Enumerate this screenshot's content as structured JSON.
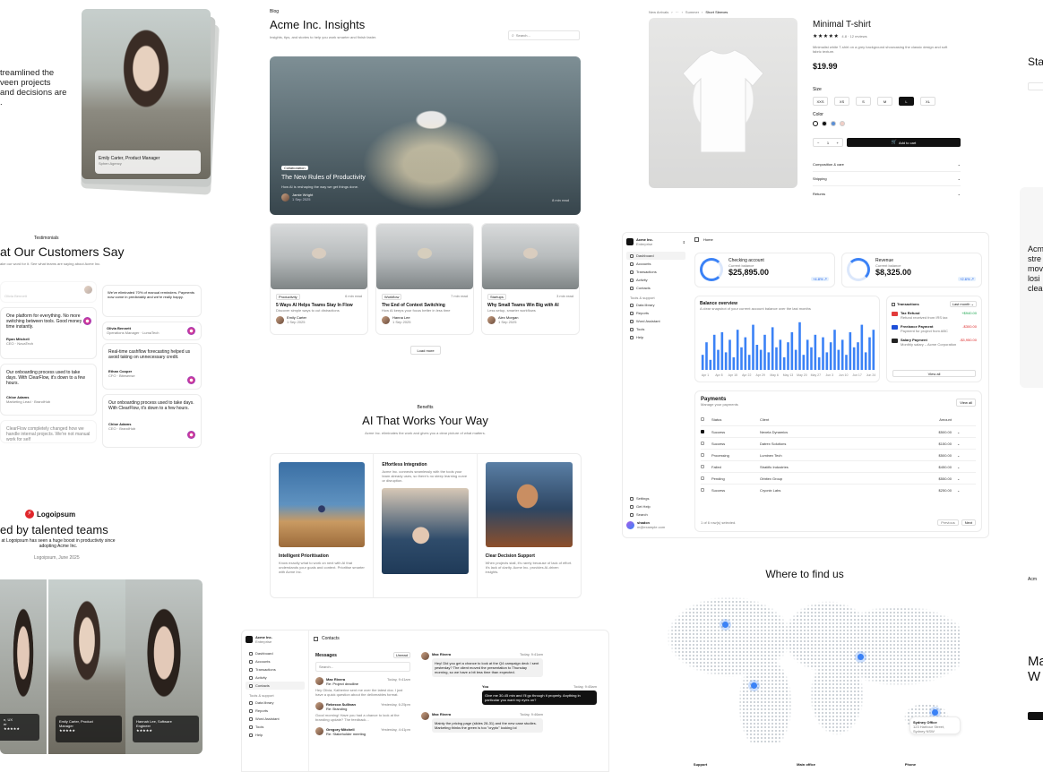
{
  "hero_left": {
    "text_lines": [
      "treamlined the",
      "veen projects",
      "and decisions are",
      "."
    ],
    "person_card": {
      "name": "Emily Carter, Product Manager",
      "company": "Sphen Agency"
    }
  },
  "testimonials": {
    "eyebrow": "Testimonials",
    "title": "at Our Customers Say",
    "subtitle": "ake our word for it. See what teams are saying about Acme Inc.",
    "items": [
      {
        "quote": "One platform for everything. No more switching between tools. Good money and time instantly.",
        "name": "Ryan Mitchell",
        "role": "CEO · NovaTech"
      },
      {
        "quote": "Our onboarding process used to take days. With ClearFlow, it's down to a few hours.",
        "name": "Chloe Adams",
        "role": "Marketing Lead · BrandHub"
      },
      {
        "quote": "ClearFlow completely changed how we handle internal projects. We're not manual work for self",
        "name": "",
        "role": ""
      },
      {
        "quote": "We've eliminated 70% of manual reminders. Payments now come in predictably and we're really happy.",
        "name": "Olivia Bennett",
        "role": "Operations Manager · LumaTech"
      },
      {
        "quote": "Real-time cashflow forecasting helped us avoid taking on unnecessary credit.",
        "name": "Ethan Cooper",
        "role": "CFO · Bitesense"
      },
      {
        "quote": "Our onboarding process used to take days. With ClearFlow, it's down to a few hours.",
        "name": "Chloe Adams",
        "role": "CEO · BrandHub"
      }
    ]
  },
  "logo_section": {
    "logo_text": "Logoipsum",
    "title": "ed by talented teams",
    "quote": "at Logoipsum has seen a huge boost in productivity since adopting Acme Inc.",
    "attribution": "Logoipsum, June 2025",
    "people": [
      {
        "name": "n, UX",
        "role": "er"
      },
      {
        "name": "Emily Carter, Product",
        "role": "Manager"
      },
      {
        "name": "Hannah Lee, Software",
        "role": "Engineer"
      }
    ],
    "stars": "★★★★★"
  },
  "blog": {
    "eyebrow": "Blog",
    "title": "Acme Inc. Insights",
    "subtitle": "Insights, tips, and stories to help you work smarter and finish faster.",
    "search_placeholder": "Search...",
    "featured": {
      "tag": "Collaboration",
      "title": "The New Rules of Productivity",
      "desc": "How AI is reshaping the way we get things done.",
      "author": "Jamie Wright",
      "date": "1 Sep 2025",
      "read": "8 min read"
    },
    "posts": [
      {
        "tag": "Productivity",
        "read": "6 min read",
        "title": "5 Ways AI Helps Teams Stay In Flow",
        "desc": "Discover simple ways to cut distractions",
        "author": "Emily Carter",
        "date": "1 Sep 2025"
      },
      {
        "tag": "Workflow",
        "read": "7 min read",
        "title": "The End of Context Switching",
        "desc": "How AI keeps your focus better in less time",
        "author": "Hanna Lee",
        "date": "1 Sep 2025"
      },
      {
        "tag": "Startups",
        "read": "3 min read",
        "title": "Why Small Teams Win Big with AI",
        "desc": "Less setup, smarter workflows",
        "author": "Alex Morgan",
        "date": "1 Sep 2025"
      }
    ],
    "load_more": "Load more"
  },
  "benefits": {
    "eyebrow": "Benefits",
    "title": "AI That Works Your Way",
    "subtitle": "Acme Inc. eliminates the work and gives you a clear picture of what matters.",
    "items": [
      {
        "title": "Intelligent Prioritisation",
        "desc": "Know exactly what to work on next with AI that understands your goals and context. Prioritise smarter with Acme Inc."
      },
      {
        "title": "Effortless Integration",
        "desc": "Acme Inc. connects seamlessly with the tools your team already uses, so there's no steep learning curve or disruption."
      },
      {
        "title": "Clear Decision Support",
        "desc": "When projects stall, it's rarely because of lack of effort. It's lack of clarity. Acme Inc. provides AI-driven insights."
      }
    ]
  },
  "product": {
    "breadcrumb": [
      "New Arrivals",
      "›",
      "···",
      "›",
      "Summer",
      "›",
      "Short Sleeves"
    ],
    "title": "Minimal T-shirt",
    "rating_stars": "★★★★★",
    "rating_count": "4.8 · 12 reviews",
    "desc": "Minimalist white T-shirt on a grey background showcasing the classic design and soft fabric texture.",
    "price": "$19.99",
    "size_label": "Size",
    "sizes": [
      "XXS",
      "XS",
      "S",
      "M",
      "L",
      "XL"
    ],
    "selected_size": "L",
    "color_label": "Color",
    "colors": [
      "#ffffff",
      "#111111",
      "#5b8fd6",
      "#f1cfc7"
    ],
    "qty": "1",
    "add_to_cart": "Add to cart",
    "accordions": [
      "Composition & care",
      "Shipping",
      "Returns"
    ]
  },
  "dashboard": {
    "brand": "Acme Inc.",
    "brand_sub": "Enterprise",
    "page": "Home",
    "nav": [
      "Dashboard",
      "Accounts",
      "Transactions",
      "Activity",
      "Contacts"
    ],
    "nav_section": "Tools & support",
    "nav2": [
      "Data library",
      "Reports",
      "Word Assistant",
      "Tools",
      "Help"
    ],
    "nav3": [
      "Settings",
      "Get Help",
      "Search"
    ],
    "user": {
      "name": "shadcn",
      "email": "m@example.com"
    },
    "checking": {
      "title": "Checking account",
      "label": "Current balance",
      "value": "$25,895.00",
      "badge": "+4.8% ↗"
    },
    "revenue": {
      "title": "Revenue",
      "label": "Current balance",
      "value": "$8,325.00",
      "badge": "+2.6% ↗"
    },
    "balance": {
      "title": "Balance overview",
      "subtitle": "A clear snapshot of your current account balance over the last months"
    },
    "transactions": {
      "title": "Transactions",
      "filter": "Last month",
      "items": [
        {
          "name": "Tax Refund",
          "sub": "Refund received from IRS tax",
          "amount": "+$940.00",
          "color": "#e23b3b"
        },
        {
          "name": "Freelance Payment",
          "sub": "Payment for project from ABC",
          "amount": "-$300.00",
          "color": "#1e4fd8"
        },
        {
          "name": "Salary Payment",
          "sub": "Monthly salary – Acme Corporation",
          "amount": "-$3,950.00",
          "color": "#222222"
        }
      ],
      "view_all": "View all"
    },
    "payments": {
      "title": "Payments",
      "subtitle": "Manage your payments",
      "view_all": "View all",
      "headers": [
        "Status",
        "Client",
        "Amount"
      ],
      "rows": [
        {
          "status": "Success",
          "client": "Nexela Dynamics",
          "amount": "$500.00",
          "checked": true
        },
        {
          "status": "Success",
          "client": "Datrex Solutions",
          "amount": "$150.00",
          "checked": false
        },
        {
          "status": "Processing",
          "client": "Luminex Tech",
          "amount": "$500.00",
          "checked": false
        },
        {
          "status": "Failed",
          "client": "Stratific Industries",
          "amount": "$450.00",
          "checked": false
        },
        {
          "status": "Pending",
          "client": "Orbitex Group",
          "amount": "$550.00",
          "checked": false
        },
        {
          "status": "Success",
          "client": "Cryonix Labs",
          "amount": "$250.00",
          "checked": false
        }
      ],
      "footer": "1 of 6 row(s) selected.",
      "prev": "Previous",
      "next": "Next"
    }
  },
  "chart_data": {
    "type": "bar",
    "title": "Balance overview",
    "xlabel": "",
    "ylabel": "",
    "categories": [
      "Apr 1",
      "Apr 3",
      "Apr 5",
      "Apr 7",
      "Apr 9",
      "Apr 11",
      "Apr 13",
      "Apr 15",
      "Apr 17",
      "Apr 19",
      "Apr 21",
      "Apr 23",
      "Apr 25",
      "Apr 27",
      "Apr 29",
      "May 1",
      "May 3",
      "May 5",
      "May 7",
      "May 9",
      "May 11",
      "May 13",
      "May 15",
      "May 17",
      "May 19",
      "May 21",
      "May 23",
      "May 25",
      "May 27",
      "May 29",
      "May 31",
      "Jun 2",
      "Jun 4",
      "Jun 6",
      "Jun 8",
      "Jun 10",
      "Jun 12",
      "Jun 14",
      "Jun 16",
      "Jun 18",
      "Jun 20",
      "Jun 22",
      "Jun 24",
      "Jun 26",
      "Jun 28"
    ],
    "values": [
      30,
      55,
      20,
      70,
      40,
      75,
      35,
      60,
      25,
      80,
      45,
      65,
      30,
      90,
      50,
      40,
      70,
      35,
      85,
      45,
      60,
      25,
      55,
      75,
      40,
      95,
      30,
      60,
      45,
      70,
      25,
      65,
      35,
      55,
      80,
      40,
      60,
      30,
      75,
      45,
      55,
      90,
      35,
      65,
      80
    ],
    "tick_labels": [
      "Apr 1",
      "Apr 8",
      "Apr 15",
      "Apr 22",
      "Apr 29",
      "May 6",
      "May 13",
      "May 20",
      "May 27",
      "Jun 3",
      "Jun 10",
      "Jun 17",
      "Jun 24"
    ],
    "color": "#3b82f6"
  },
  "map": {
    "title": "Where to find us",
    "office_name": "Sydney Office",
    "office_address": "123 Harbour Street, Sydney NSW",
    "footer": [
      "Support",
      "Main office",
      "Phone"
    ]
  },
  "messages_app": {
    "brand": "Acme Inc.",
    "brand_sub": "Enterprise",
    "page": "Contacts",
    "nav": [
      "Dashboard",
      "Accounts",
      "Transactions",
      "Activity",
      "Contacts"
    ],
    "nav_section": "Tools & support",
    "nav2": [
      "Data library",
      "Reports",
      "Word Assistant",
      "Tools",
      "Help"
    ],
    "title": "Messages",
    "filter": "Unread",
    "search_placeholder": "Search...",
    "list": [
      {
        "name": "Max Rivera",
        "subject": "Re: Project deadline",
        "time": "Today, 9:41am",
        "preview": "Hey Olivia, Katherine sent me over the latest doc. I just have a quick question about the deliverables format."
      },
      {
        "name": "Rebecca Sullivan",
        "subject": "Re: Branding",
        "time": "Yesterday, 6:25pm",
        "preview": "Good morning! Have you had a chance to look at the branding update? The feedback..."
      },
      {
        "name": "Gregory Mitchell",
        "subject": "Re: Stakeholder meeting",
        "time": "Yesterday, 4:41pm",
        "preview": "Good update, stakeholder meeting got moved to next week"
      }
    ],
    "chat": [
      {
        "from": "Max Rivera",
        "time": "Today, 9:41am",
        "text": "Hey! Did you get a chance to look at the Q4 campaign deck I sent yesterday? The client moved the presentation to Thursday morning, so we have a bit less time than expected.",
        "me": false
      },
      {
        "from": "You",
        "time": "Today, 9:45am",
        "text": "Give me 30-45 min and I'll go through it properly. Anything in particular you want my eyes on?",
        "me": true
      },
      {
        "from": "Max Rivera",
        "time": "Today, 9:46am",
        "text": "Mainly the pricing page (slides 28-31) and the new case studies. Marketing thinks the green is too \"crypto\" looking lol",
        "me": false
      }
    ]
  },
  "far_right": {
    "title_part": "Sta",
    "article_lines": [
      "Acm",
      "stre",
      "mov",
      "losi",
      "clea"
    ],
    "footer_logo": "Acm",
    "bottom_title": [
      "Ma",
      "W"
    ]
  }
}
